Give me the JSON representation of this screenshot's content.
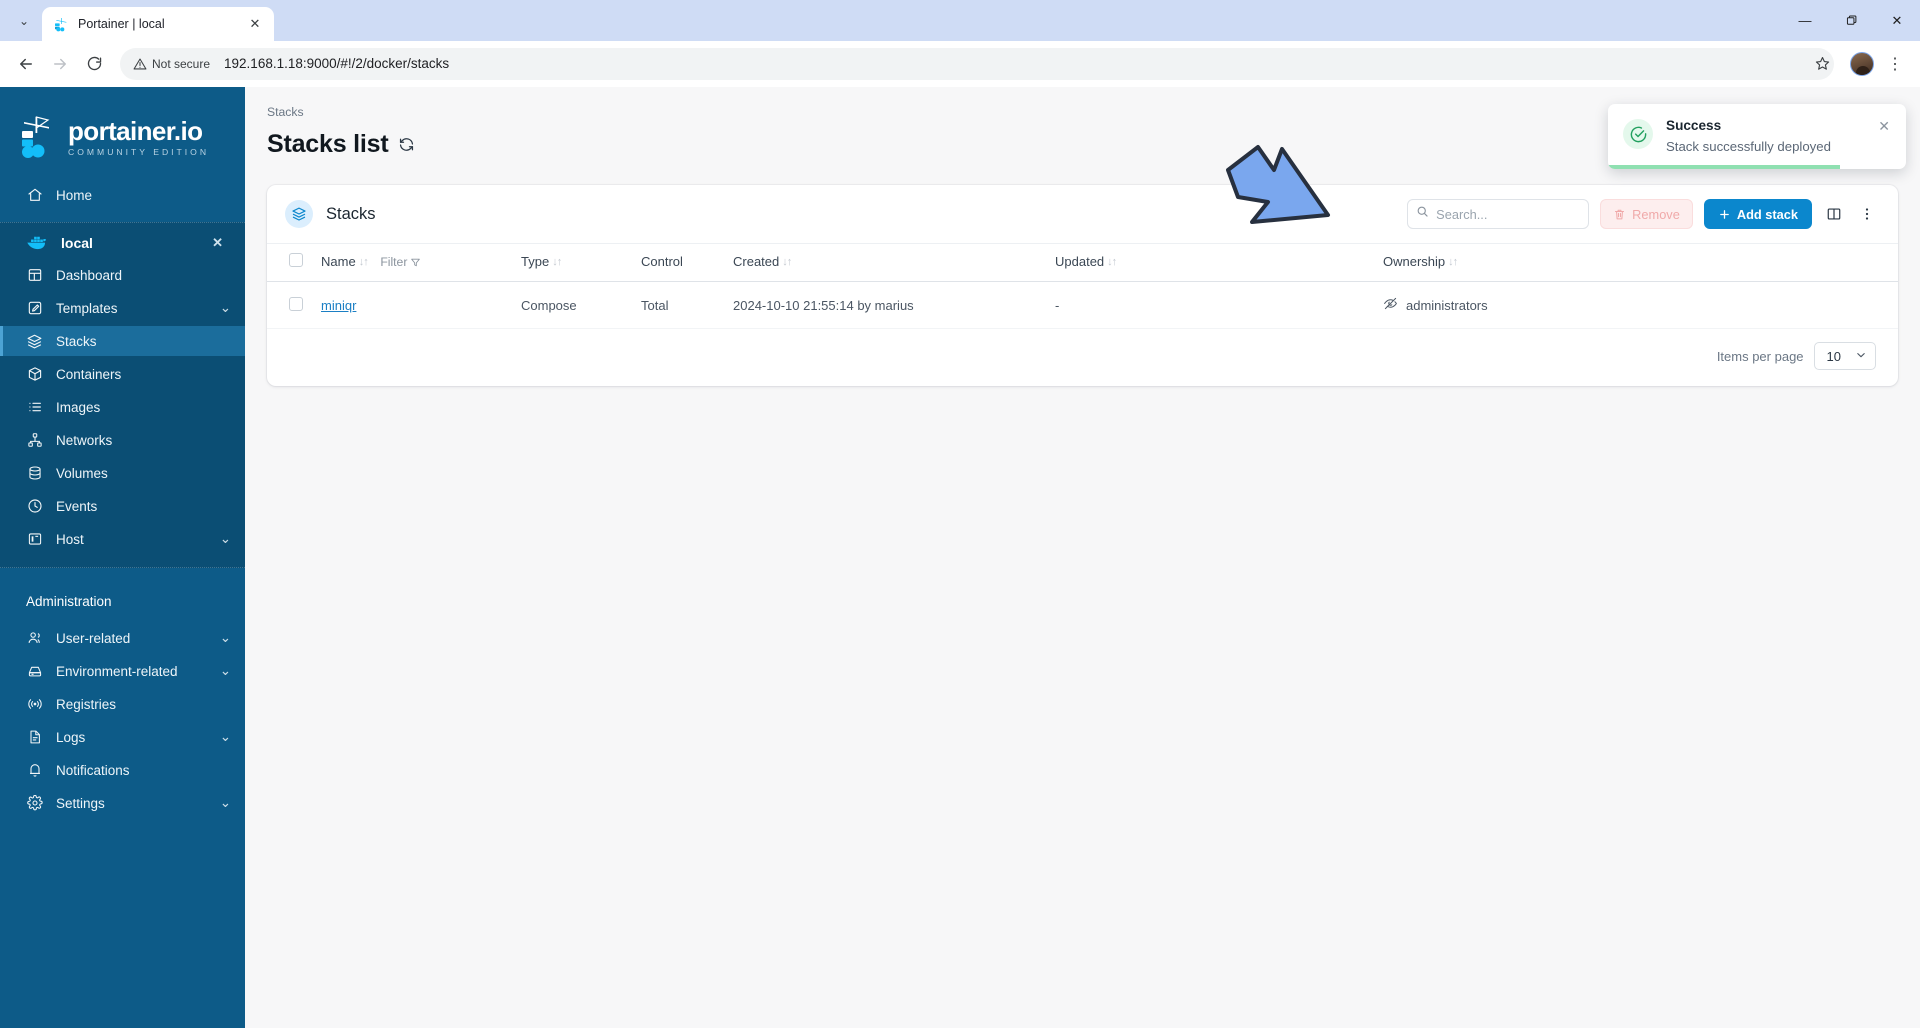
{
  "browser": {
    "tab": {
      "title": "Portainer | local",
      "favicon": "portainer-favicon",
      "close_label": "✕"
    },
    "tab_list_chevron": "⌄",
    "window_controls": {
      "minimize": "—",
      "maximize": "❐",
      "close": "✕"
    },
    "nav": {
      "back": "←",
      "forward": "→",
      "reload": "⟳"
    },
    "omnibox": {
      "security_label": "Not secure",
      "url": "192.168.1.18:9000/#!/2/docker/stacks",
      "star": "☆"
    },
    "menu": "⋮"
  },
  "sidebar": {
    "logo": {
      "word": "portainer.io",
      "edition": "COMMUNITY EDITION"
    },
    "collapse_label": "«",
    "home": {
      "label": "Home",
      "icon": "home-icon"
    },
    "environment": {
      "name": "local",
      "icon": "docker-icon",
      "close": "✕",
      "items": [
        {
          "label": "Dashboard",
          "icon": "dashboard-icon",
          "chevron": ""
        },
        {
          "label": "Templates",
          "icon": "templates-icon",
          "chevron": "⌄"
        },
        {
          "label": "Stacks",
          "icon": "stacks-icon",
          "chevron": "",
          "active": true
        },
        {
          "label": "Containers",
          "icon": "containers-icon",
          "chevron": ""
        },
        {
          "label": "Images",
          "icon": "images-icon",
          "chevron": ""
        },
        {
          "label": "Networks",
          "icon": "networks-icon",
          "chevron": ""
        },
        {
          "label": "Volumes",
          "icon": "volumes-icon",
          "chevron": ""
        },
        {
          "label": "Events",
          "icon": "events-icon",
          "chevron": ""
        },
        {
          "label": "Host",
          "icon": "host-icon",
          "chevron": "⌄"
        }
      ]
    },
    "admin_section_title": "Administration",
    "admin_items": [
      {
        "label": "User-related",
        "icon": "users-icon",
        "chevron": "⌄"
      },
      {
        "label": "Environment-related",
        "icon": "environment-icon",
        "chevron": "⌄"
      },
      {
        "label": "Registries",
        "icon": "registries-icon",
        "chevron": ""
      },
      {
        "label": "Logs",
        "icon": "logs-icon",
        "chevron": "⌄"
      },
      {
        "label": "Notifications",
        "icon": "bell-icon",
        "chevron": ""
      },
      {
        "label": "Settings",
        "icon": "settings-icon",
        "chevron": "⌄"
      }
    ]
  },
  "main": {
    "breadcrumb": "Stacks",
    "page_title": "Stacks list",
    "refresh_icon": "refresh-icon",
    "card": {
      "title": "Stacks",
      "icon": "stacks-icon",
      "search": {
        "placeholder": "Search...",
        "value": "",
        "clear": "✕"
      },
      "remove_button": "Remove",
      "add_button": "Add stack",
      "columns_button": "columns-icon",
      "more_button": "⋮"
    },
    "table": {
      "columns": [
        {
          "label": "Name",
          "sortable": true,
          "filter": "Filter"
        },
        {
          "label": "Type",
          "sortable": true
        },
        {
          "label": "Control",
          "sortable": false
        },
        {
          "label": "Created",
          "sortable": true
        },
        {
          "label": "Updated",
          "sortable": true
        },
        {
          "label": "Ownership",
          "sortable": true
        }
      ],
      "rows": [
        {
          "name": "miniqr",
          "type": "Compose",
          "control": "Total",
          "created": "2024-10-10 21:55:14 by marius",
          "updated": "-",
          "ownership": "administrators",
          "ownership_icon": "eye-off-icon"
        }
      ]
    },
    "footer": {
      "items_per_page_label": "Items per page",
      "items_per_page_value": "10",
      "chevron": "⌄"
    }
  },
  "toast": {
    "title": "Success",
    "message": "Stack successfully deployed",
    "close": "✕",
    "icon": "check-circle-icon",
    "progress_percent": 78
  },
  "annotation": {
    "arrow": {
      "name": "pointer-arrow",
      "fill": "#7aa7ee",
      "stroke": "#27303f"
    }
  },
  "colors": {
    "sidebar_bg": "#0d5b88",
    "sidebar_active": "#1b6d9c",
    "accent_blue": "#0b87cd",
    "success_green": "#2aa96a",
    "page_bg": "#f7f7f8"
  }
}
